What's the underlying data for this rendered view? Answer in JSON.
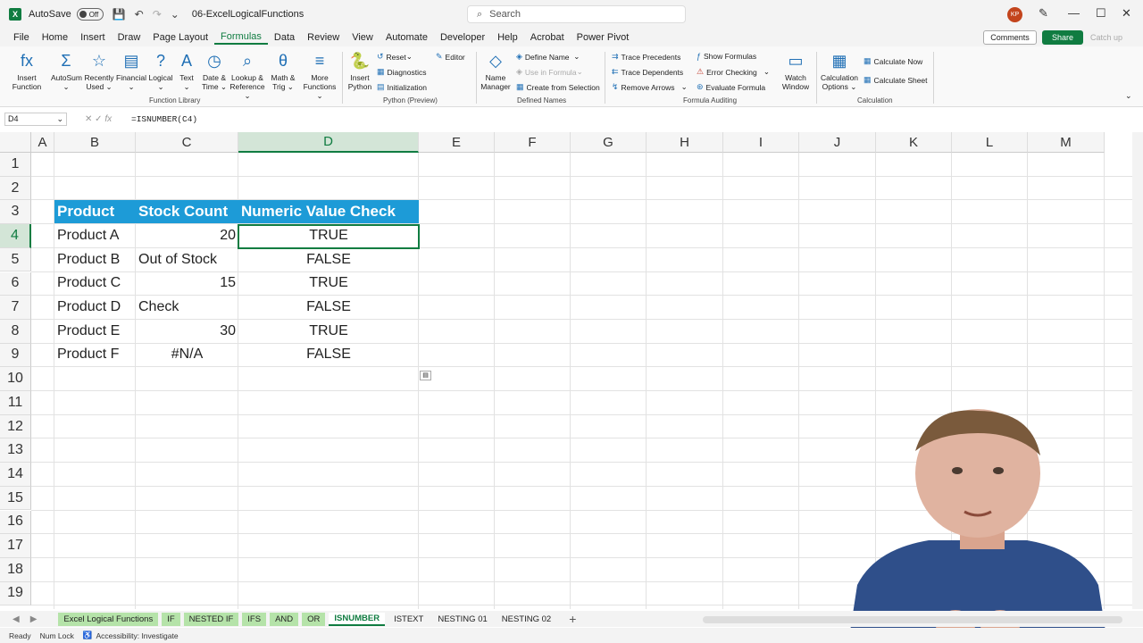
{
  "titlebar": {
    "autosave_label": "AutoSave",
    "autosave_state": "Off",
    "filename": "06-ExcelLogicalFunctions",
    "search_placeholder": "Search",
    "user_initials": "KP"
  },
  "menu": [
    "File",
    "Home",
    "Insert",
    "Draw",
    "Page Layout",
    "Formulas",
    "Data",
    "Review",
    "View",
    "Automate",
    "Developer",
    "Help",
    "Acrobat",
    "Power Pivot"
  ],
  "menu_active": "Formulas",
  "header_buttons": {
    "comments": "Comments",
    "share": "Share",
    "catchup": "Catch up"
  },
  "ribbon": {
    "function_library": {
      "label": "Function Library",
      "buttons": [
        {
          "line1": "Insert",
          "line2": "Function",
          "icon": "fx"
        },
        {
          "line1": "AutoSum",
          "line2": "⌄",
          "icon": "Σ"
        },
        {
          "line1": "Recently",
          "line2": "Used ⌄",
          "icon": "☆"
        },
        {
          "line1": "Financial",
          "line2": "⌄",
          "icon": "▤"
        },
        {
          "line1": "Logical",
          "line2": "⌄",
          "icon": "?"
        },
        {
          "line1": "Text",
          "line2": "⌄",
          "icon": "A"
        },
        {
          "line1": "Date &",
          "line2": "Time ⌄",
          "icon": "◷"
        },
        {
          "line1": "Lookup &",
          "line2": "Reference ⌄",
          "icon": "⌕"
        },
        {
          "line1": "Math &",
          "line2": "Trig ⌄",
          "icon": "θ"
        },
        {
          "line1": "More",
          "line2": "Functions ⌄",
          "icon": "≡"
        }
      ]
    },
    "python": {
      "label": "Python (Preview)",
      "insert": {
        "line1": "Insert",
        "line2": "Python"
      },
      "small": [
        "Reset",
        "Diagnostics",
        "Initialization"
      ],
      "editor": "Editor"
    },
    "defined_names": {
      "label": "Defined Names",
      "name_manager": {
        "line1": "Name",
        "line2": "Manager"
      },
      "small": [
        "Define Name",
        "Use in Formula",
        "Create from Selection"
      ]
    },
    "formula_auditing": {
      "label": "Formula Auditing",
      "left": [
        "Trace Precedents",
        "Trace Dependents",
        "Remove Arrows"
      ],
      "right": [
        "Show Formulas",
        "Error Checking",
        "Evaluate Formula"
      ],
      "watch": {
        "line1": "Watch",
        "line2": "Window"
      }
    },
    "calculation": {
      "label": "Calculation",
      "options": {
        "line1": "Calculation",
        "line2": "Options ⌄"
      },
      "small": [
        "Calculate Now",
        "Calculate Sheet"
      ]
    }
  },
  "formula_bar": {
    "namebox": "D4",
    "formula": "=ISNUMBER(C4)"
  },
  "columns": [
    "A",
    "B",
    "C",
    "D",
    "E",
    "F",
    "G",
    "H",
    "I",
    "J",
    "K",
    "L",
    "M"
  ],
  "rows": [
    "1",
    "2",
    "3",
    "4",
    "5",
    "6",
    "7",
    "8",
    "9",
    "10",
    "11",
    "12",
    "13",
    "14",
    "15",
    "16",
    "17",
    "18",
    "19"
  ],
  "table": {
    "headers": [
      "Product",
      "Stock Count",
      "Numeric Value Check"
    ],
    "rows": [
      {
        "product": "Product A",
        "stock": "20",
        "check": "TRUE"
      },
      {
        "product": "Product B",
        "stock": "Out of Stock",
        "check": "FALSE"
      },
      {
        "product": "Product C",
        "stock": "15",
        "check": "TRUE"
      },
      {
        "product": "Product D",
        "stock": "Check",
        "check": "FALSE"
      },
      {
        "product": "Product E",
        "stock": "30",
        "check": "TRUE"
      },
      {
        "product": "Product F",
        "stock": "#N/A",
        "check": "FALSE"
      }
    ]
  },
  "sheet_tabs": [
    "Excel Logical Functions",
    "IF",
    "NESTED IF",
    "IFS",
    "AND",
    "OR",
    "ISNUMBER",
    "ISTEXT",
    "NESTING 01",
    "NESTING 02"
  ],
  "active_tab": "ISNUMBER",
  "status": {
    "ready": "Ready",
    "numlock": "Num Lock",
    "accessibility": "Accessibility: Investigate"
  },
  "colors": {
    "accent": "#107c41",
    "table_header": "#1d9bd7"
  }
}
